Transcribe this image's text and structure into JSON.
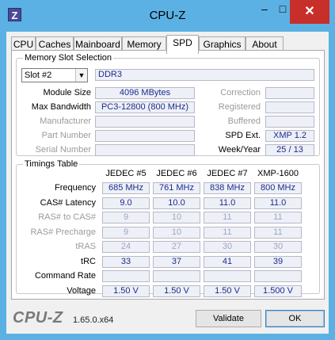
{
  "window": {
    "icon_letter": "Z",
    "title": "CPU-Z",
    "controls": {
      "minimize": "–",
      "maximize": "□",
      "close": "✕"
    }
  },
  "tabs": [
    "CPU",
    "Caches",
    "Mainboard",
    "Memory",
    "SPD",
    "Graphics",
    "About"
  ],
  "active_tab": "SPD",
  "memory_slot": {
    "group_title": "Memory Slot Selection",
    "slot": "Slot #2",
    "type": "DDR3",
    "labels": {
      "module_size": "Module Size",
      "max_bandwidth": "Max Bandwidth",
      "manufacturer": "Manufacturer",
      "part_number": "Part Number",
      "serial_number": "Serial Number",
      "correction": "Correction",
      "registered": "Registered",
      "buffered": "Buffered",
      "spd_ext": "SPD Ext.",
      "week_year": "Week/Year"
    },
    "values": {
      "module_size": "4096 MBytes",
      "max_bandwidth": "PC3-12800 (800 MHz)",
      "manufacturer": "",
      "part_number": "",
      "serial_number": "",
      "correction": "",
      "registered": "",
      "buffered": "",
      "spd_ext": "XMP 1.2",
      "week_year": "25 / 13"
    }
  },
  "timings": {
    "group_title": "Timings Table",
    "columns": [
      "JEDEC #5",
      "JEDEC #6",
      "JEDEC #7",
      "XMP-1600"
    ],
    "rows": [
      {
        "label": "Frequency",
        "values": [
          "685 MHz",
          "761 MHz",
          "838 MHz",
          "800 MHz"
        ],
        "dim": false
      },
      {
        "label": "CAS# Latency",
        "values": [
          "9.0",
          "10.0",
          "11.0",
          "11.0"
        ],
        "dim": false
      },
      {
        "label": "RAS# to CAS#",
        "values": [
          "9",
          "10",
          "11",
          "11"
        ],
        "dim": true
      },
      {
        "label": "RAS# Precharge",
        "values": [
          "9",
          "10",
          "11",
          "11"
        ],
        "dim": true
      },
      {
        "label": "tRAS",
        "values": [
          "24",
          "27",
          "30",
          "30"
        ],
        "dim": true
      },
      {
        "label": "tRC",
        "values": [
          "33",
          "37",
          "41",
          "39"
        ],
        "dim": false
      },
      {
        "label": "Command Rate",
        "values": [
          "",
          "",
          "",
          ""
        ],
        "dim": false
      },
      {
        "label": "Voltage",
        "values": [
          "1.50 V",
          "1.50 V",
          "1.50 V",
          "1.500 V"
        ],
        "dim": false
      }
    ]
  },
  "footer": {
    "logo": "CPU-Z",
    "version": "1.65.0.x64",
    "validate_label": "Validate",
    "ok_label": "OK"
  }
}
